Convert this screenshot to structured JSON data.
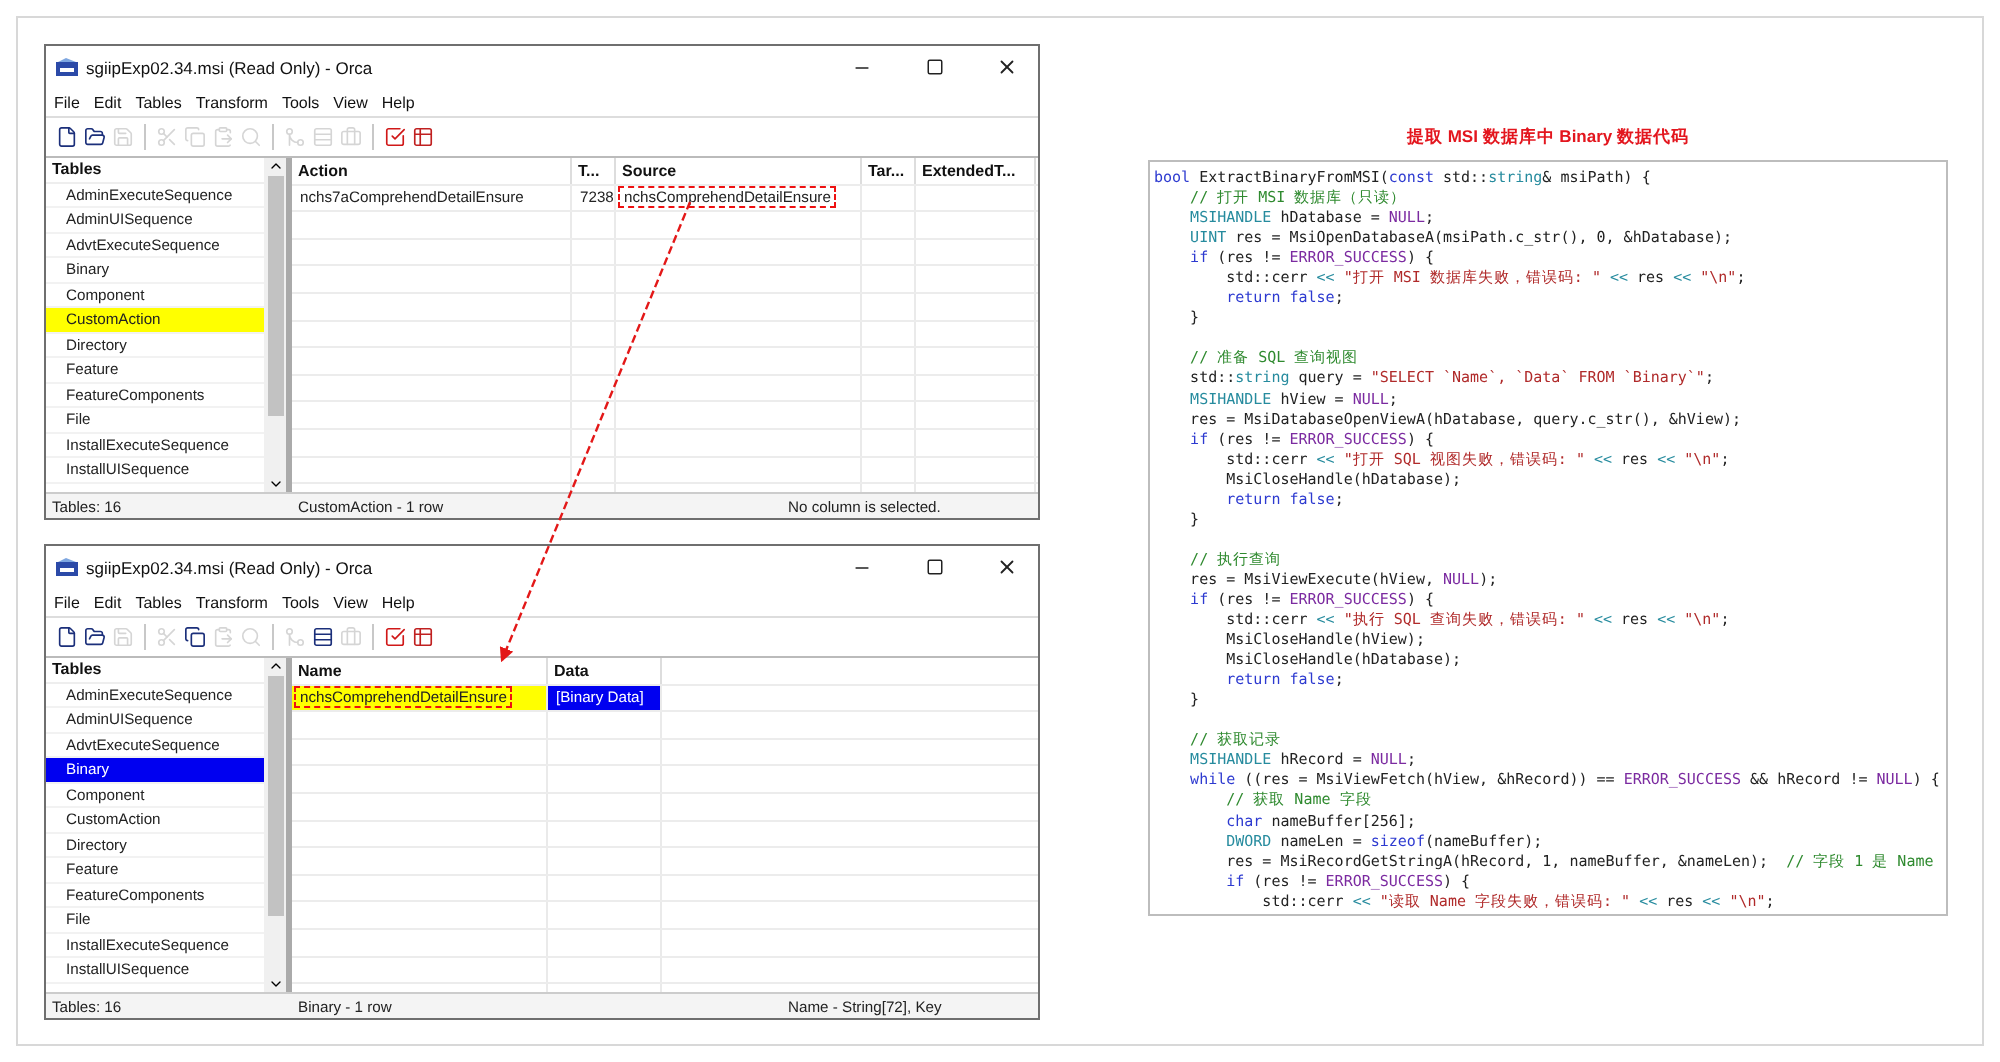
{
  "windows": [
    {
      "title": "sgiipExp02.34.msi (Read Only) - Orca",
      "menu": [
        "File",
        "Edit",
        "Tables",
        "Transform",
        "Tools",
        "View",
        "Help"
      ],
      "toolbar": [
        {
          "kind": "new",
          "disabled": false
        },
        {
          "kind": "open",
          "disabled": false
        },
        {
          "kind": "save",
          "disabled": true
        },
        {
          "kind": "cut",
          "disabled": true
        },
        {
          "kind": "copy",
          "disabled": true
        },
        {
          "kind": "paste",
          "disabled": true
        },
        {
          "kind": "find",
          "disabled": true
        },
        {
          "kind": "merge",
          "disabled": true
        },
        {
          "kind": "row",
          "disabled": true
        },
        {
          "kind": "case",
          "disabled": true
        },
        {
          "kind": "validate",
          "disabled": false
        },
        {
          "kind": "table",
          "disabled": false
        }
      ],
      "tables_header": "Tables",
      "tables": [
        {
          "label": "AdminExecuteSequence",
          "selected": false,
          "highlighted": false
        },
        {
          "label": "AdminUISequence",
          "selected": false,
          "highlighted": false
        },
        {
          "label": "AdvtExecuteSequence",
          "selected": false,
          "highlighted": false
        },
        {
          "label": "Binary",
          "selected": false,
          "highlighted": false
        },
        {
          "label": "Component",
          "selected": false,
          "highlighted": false
        },
        {
          "label": "CustomAction",
          "selected": false,
          "highlighted": true
        },
        {
          "label": "Directory",
          "selected": false,
          "highlighted": false
        },
        {
          "label": "Feature",
          "selected": false,
          "highlighted": false
        },
        {
          "label": "FeatureComponents",
          "selected": false,
          "highlighted": false
        },
        {
          "label": "File",
          "selected": false,
          "highlighted": false
        },
        {
          "label": "InstallExecuteSequence",
          "selected": false,
          "highlighted": false
        },
        {
          "label": "InstallUISequence",
          "selected": false,
          "highlighted": false
        }
      ],
      "columns": [
        "Action",
        "T...",
        "Source",
        "Tar...",
        "ExtendedT..."
      ],
      "rows": [
        [
          {
            "text": "nchs7aComprehendDetailEnsure",
            "selected": false,
            "highlighted": false,
            "boxed": false
          },
          {
            "text": "7238",
            "selected": false,
            "highlighted": false,
            "boxed": false
          },
          {
            "text": "nchsComprehendDetailEnsure",
            "selected": false,
            "highlighted": false,
            "boxed": true
          }
        ]
      ],
      "status": [
        "Tables: 16",
        "CustomAction - 1 row",
        "No column is selected."
      ]
    },
    {
      "title": "sgiipExp02.34.msi (Read Only) - Orca",
      "menu": [
        "File",
        "Edit",
        "Tables",
        "Transform",
        "Tools",
        "View",
        "Help"
      ],
      "toolbar": [
        {
          "kind": "new",
          "disabled": false
        },
        {
          "kind": "open",
          "disabled": false
        },
        {
          "kind": "save",
          "disabled": true
        },
        {
          "kind": "cut",
          "disabled": true
        },
        {
          "kind": "copy",
          "disabled": false
        },
        {
          "kind": "paste",
          "disabled": true
        },
        {
          "kind": "find",
          "disabled": true
        },
        {
          "kind": "merge",
          "disabled": true
        },
        {
          "kind": "row",
          "disabled": false
        },
        {
          "kind": "case",
          "disabled": true
        },
        {
          "kind": "validate",
          "disabled": false
        },
        {
          "kind": "table",
          "disabled": false
        }
      ],
      "tables_header": "Tables",
      "tables": [
        {
          "label": "AdminExecuteSequence",
          "selected": false,
          "highlighted": false
        },
        {
          "label": "AdminUISequence",
          "selected": false,
          "highlighted": false
        },
        {
          "label": "AdvtExecuteSequence",
          "selected": false,
          "highlighted": false
        },
        {
          "label": "Binary",
          "selected": true,
          "highlighted": false
        },
        {
          "label": "Component",
          "selected": false,
          "highlighted": false
        },
        {
          "label": "CustomAction",
          "selected": false,
          "highlighted": false
        },
        {
          "label": "Directory",
          "selected": false,
          "highlighted": false
        },
        {
          "label": "Feature",
          "selected": false,
          "highlighted": false
        },
        {
          "label": "FeatureComponents",
          "selected": false,
          "highlighted": false
        },
        {
          "label": "File",
          "selected": false,
          "highlighted": false
        },
        {
          "label": "InstallExecuteSequence",
          "selected": false,
          "highlighted": false
        },
        {
          "label": "InstallUISequence",
          "selected": false,
          "highlighted": false
        }
      ],
      "columns": [
        "Name",
        "Data"
      ],
      "rows": [
        [
          {
            "text": "nchsComprehendDetailEnsure",
            "selected": false,
            "highlighted": true,
            "boxed": true
          },
          {
            "text": "[Binary Data]",
            "selected": true,
            "highlighted": false,
            "boxed": false
          }
        ]
      ],
      "status": [
        "Tables: 16",
        "Binary - 1 row",
        "Name - String[72], Key"
      ]
    }
  ],
  "code_title": "提取 MSI 数据库中 Binary 数据代码",
  "code_lines": [
    {
      "kind": "code",
      "tokens": [
        {
          "kind": "kw",
          "text": "bool"
        },
        {
          "kind": "p",
          "text": " ExtractBinaryFromMSI("
        },
        {
          "kind": "kw",
          "text": "const"
        },
        {
          "kind": "p",
          "text": " std::"
        },
        {
          "kind": "ty",
          "text": "string"
        },
        {
          "kind": "p",
          "text": "& msiPath) {"
        }
      ]
    },
    {
      "kind": "code",
      "tokens": [
        {
          "kind": "cm",
          "text": "    // 打开 MSI 数据库（只读）"
        }
      ]
    },
    {
      "kind": "code",
      "tokens": [
        {
          "kind": "ty",
          "text": "    MSIHANDLE"
        },
        {
          "kind": "p",
          "text": " hDatabase = "
        },
        {
          "kind": "mc",
          "text": "NULL"
        },
        {
          "kind": "p",
          "text": ";"
        }
      ]
    },
    {
      "kind": "code",
      "tokens": [
        {
          "kind": "ty",
          "text": "    UINT"
        },
        {
          "kind": "p",
          "text": " res = MsiOpenDatabaseA(msiPath.c_str(), 0, &hDatabase);"
        }
      ]
    },
    {
      "kind": "code",
      "tokens": [
        {
          "kind": "kw",
          "text": "    if"
        },
        {
          "kind": "p",
          "text": " (res != "
        },
        {
          "kind": "mc",
          "text": "ERROR_SUCCESS"
        },
        {
          "kind": "p",
          "text": ") {"
        }
      ]
    },
    {
      "kind": "code",
      "tokens": [
        {
          "kind": "p",
          "text": "        std::cerr "
        },
        {
          "kind": "ty",
          "text": "<<"
        },
        {
          "kind": "st",
          "text": " \"打开 MSI 数据库失败，错误码: \" "
        },
        {
          "kind": "ty",
          "text": "<<"
        },
        {
          "kind": "p",
          "text": " res "
        },
        {
          "kind": "ty",
          "text": "<<"
        },
        {
          "kind": "st",
          "text": " \"\\n\""
        },
        {
          "kind": "p",
          "text": ";"
        }
      ]
    },
    {
      "kind": "code",
      "tokens": [
        {
          "kind": "kw",
          "text": "        return false"
        },
        {
          "kind": "p",
          "text": ";"
        }
      ]
    },
    {
      "kind": "code",
      "tokens": [
        {
          "kind": "p",
          "text": "    }"
        }
      ]
    },
    {
      "kind": "blank"
    },
    {
      "kind": "code",
      "tokens": [
        {
          "kind": "cm",
          "text": "    // 准备 SQL 查询视图"
        }
      ]
    },
    {
      "kind": "code",
      "tokens": [
        {
          "kind": "p",
          "text": "    std::"
        },
        {
          "kind": "ty",
          "text": "string"
        },
        {
          "kind": "p",
          "text": " query = "
        },
        {
          "kind": "st",
          "text": "\"SELECT `Name`, `Data` FROM `Binary`\""
        },
        {
          "kind": "p",
          "text": ";"
        }
      ]
    },
    {
      "kind": "code",
      "tokens": [
        {
          "kind": "ty",
          "text": "    MSIHANDLE"
        },
        {
          "kind": "p",
          "text": " hView = "
        },
        {
          "kind": "mc",
          "text": "NULL"
        },
        {
          "kind": "p",
          "text": ";"
        }
      ]
    },
    {
      "kind": "code",
      "tokens": [
        {
          "kind": "p",
          "text": "    res = MsiDatabaseOpenViewA(hDatabase, query.c_str(), &hView);"
        }
      ]
    },
    {
      "kind": "code",
      "tokens": [
        {
          "kind": "kw",
          "text": "    if"
        },
        {
          "kind": "p",
          "text": " (res != "
        },
        {
          "kind": "mc",
          "text": "ERROR_SUCCESS"
        },
        {
          "kind": "p",
          "text": ") {"
        }
      ]
    },
    {
      "kind": "code",
      "tokens": [
        {
          "kind": "p",
          "text": "        std::cerr "
        },
        {
          "kind": "ty",
          "text": "<<"
        },
        {
          "kind": "st",
          "text": " \"打开 SQL 视图失败，错误码: \" "
        },
        {
          "kind": "ty",
          "text": "<<"
        },
        {
          "kind": "p",
          "text": " res "
        },
        {
          "kind": "ty",
          "text": "<<"
        },
        {
          "kind": "st",
          "text": " \"\\n\""
        },
        {
          "kind": "p",
          "text": ";"
        }
      ]
    },
    {
      "kind": "code",
      "tokens": [
        {
          "kind": "p",
          "text": "        MsiCloseHandle(hDatabase);"
        }
      ]
    },
    {
      "kind": "code",
      "tokens": [
        {
          "kind": "kw",
          "text": "        return false"
        },
        {
          "kind": "p",
          "text": ";"
        }
      ]
    },
    {
      "kind": "code",
      "tokens": [
        {
          "kind": "p",
          "text": "    }"
        }
      ]
    },
    {
      "kind": "blank"
    },
    {
      "kind": "code",
      "tokens": [
        {
          "kind": "cm",
          "text": "    // 执行查询"
        }
      ]
    },
    {
      "kind": "code",
      "tokens": [
        {
          "kind": "p",
          "text": "    res = MsiViewExecute(hView, "
        },
        {
          "kind": "mc",
          "text": "NULL"
        },
        {
          "kind": "p",
          "text": ");"
        }
      ]
    },
    {
      "kind": "code",
      "tokens": [
        {
          "kind": "kw",
          "text": "    if"
        },
        {
          "kind": "p",
          "text": " (res != "
        },
        {
          "kind": "mc",
          "text": "ERROR_SUCCESS"
        },
        {
          "kind": "p",
          "text": ") {"
        }
      ]
    },
    {
      "kind": "code",
      "tokens": [
        {
          "kind": "p",
          "text": "        std::cerr "
        },
        {
          "kind": "ty",
          "text": "<<"
        },
        {
          "kind": "st",
          "text": " \"执行 SQL 查询失败，错误码: \" "
        },
        {
          "kind": "ty",
          "text": "<<"
        },
        {
          "kind": "p",
          "text": " res "
        },
        {
          "kind": "ty",
          "text": "<<"
        },
        {
          "kind": "st",
          "text": " \"\\n\""
        },
        {
          "kind": "p",
          "text": ";"
        }
      ]
    },
    {
      "kind": "code",
      "tokens": [
        {
          "kind": "p",
          "text": "        MsiCloseHandle(hView);"
        }
      ]
    },
    {
      "kind": "code",
      "tokens": [
        {
          "kind": "p",
          "text": "        MsiCloseHandle(hDatabase);"
        }
      ]
    },
    {
      "kind": "code",
      "tokens": [
        {
          "kind": "kw",
          "text": "        return false"
        },
        {
          "kind": "p",
          "text": ";"
        }
      ]
    },
    {
      "kind": "code",
      "tokens": [
        {
          "kind": "p",
          "text": "    }"
        }
      ]
    },
    {
      "kind": "blank"
    },
    {
      "kind": "code",
      "tokens": [
        {
          "kind": "cm",
          "text": "    // 获取记录"
        }
      ]
    },
    {
      "kind": "code",
      "tokens": [
        {
          "kind": "ty",
          "text": "    MSIHANDLE"
        },
        {
          "kind": "p",
          "text": " hRecord = "
        },
        {
          "kind": "mc",
          "text": "NULL"
        },
        {
          "kind": "p",
          "text": ";"
        }
      ]
    },
    {
      "kind": "code",
      "tokens": [
        {
          "kind": "kw",
          "text": "    while"
        },
        {
          "kind": "p",
          "text": " ((res = MsiViewFetch(hView, &hRecord)) == "
        },
        {
          "kind": "mc",
          "text": "ERROR_SUCCESS"
        },
        {
          "kind": "p",
          "text": " && hRecord != "
        },
        {
          "kind": "mc",
          "text": "NULL"
        },
        {
          "kind": "p",
          "text": ") {"
        }
      ]
    },
    {
      "kind": "code",
      "tokens": [
        {
          "kind": "cm",
          "text": "        // 获取 Name 字段"
        }
      ]
    },
    {
      "kind": "code",
      "tokens": [
        {
          "kind": "kw",
          "text": "        char"
        },
        {
          "kind": "p",
          "text": " nameBuffer[256];"
        }
      ]
    },
    {
      "kind": "code",
      "tokens": [
        {
          "kind": "ty",
          "text": "        DWORD"
        },
        {
          "kind": "p",
          "text": " nameLen = "
        },
        {
          "kind": "kw",
          "text": "sizeof"
        },
        {
          "kind": "p",
          "text": "(nameBuffer);"
        }
      ]
    },
    {
      "kind": "code",
      "tokens": [
        {
          "kind": "p",
          "text": "        res = MsiRecordGetStringA(hRecord, 1, nameBuffer, &nameLen);  "
        },
        {
          "kind": "cm",
          "text": "// 字段 1 是 Name"
        }
      ]
    },
    {
      "kind": "code",
      "tokens": [
        {
          "kind": "kw",
          "text": "        if"
        },
        {
          "kind": "p",
          "text": " (res != "
        },
        {
          "kind": "mc",
          "text": "ERROR_SUCCESS"
        },
        {
          "kind": "p",
          "text": ") {"
        }
      ]
    },
    {
      "kind": "code",
      "tokens": [
        {
          "kind": "p",
          "text": "            std::cerr "
        },
        {
          "kind": "ty",
          "text": "<<"
        },
        {
          "kind": "st",
          "text": " \"读取 Name 字段失败，错误码: \" "
        },
        {
          "kind": "ty",
          "text": "<<"
        },
        {
          "kind": "p",
          "text": " res "
        },
        {
          "kind": "ty",
          "text": "<<"
        },
        {
          "kind": "st",
          "text": " \"\\n\""
        },
        {
          "kind": "p",
          "text": ";"
        }
      ]
    }
  ]
}
